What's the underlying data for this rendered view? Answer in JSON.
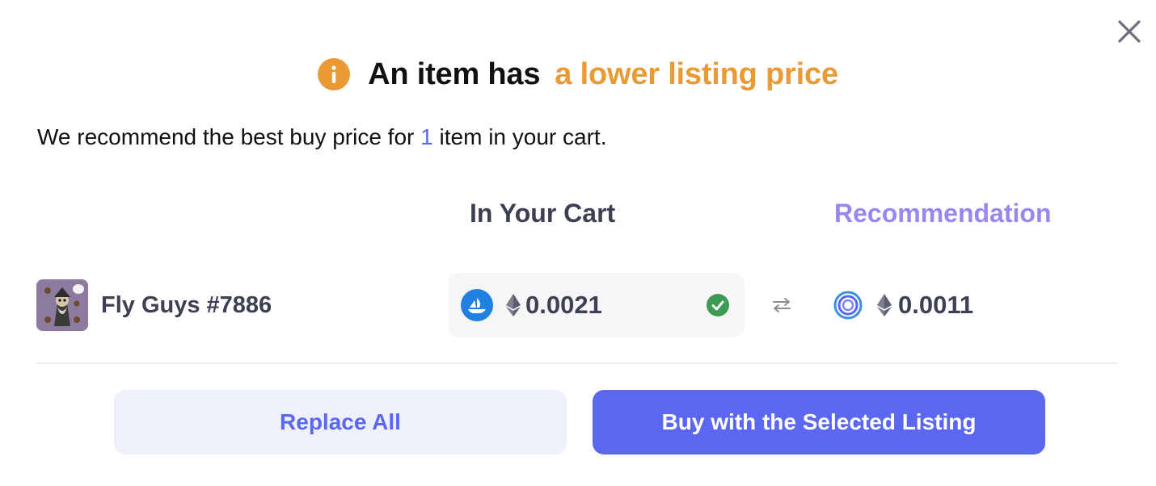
{
  "dialog": {
    "title_main": "An item has",
    "title_highlight": "a lower listing price",
    "subtitle_prefix": "We recommend the best buy price for",
    "subtitle_count": "1",
    "subtitle_suffix": "item in your cart.",
    "close_icon": "close-icon",
    "info_icon": "info-icon"
  },
  "columns": {
    "cart": "In Your Cart",
    "recommendation": "Recommendation"
  },
  "items": [
    {
      "name": "Fly Guys #7886",
      "cart_marketplace_icon": "opensea-icon",
      "cart_price": "0.0021",
      "cart_selected": true,
      "recommendation_marketplace_icon": "marketplace-ring-icon",
      "recommendation_price": "0.0011",
      "currency_icon": "ethereum-icon"
    }
  ],
  "actions": {
    "replace_all": "Replace All",
    "buy_selected": "Buy with the Selected Listing"
  },
  "colors": {
    "accent": "#5b67f0",
    "warning": "#e99a34",
    "recommendation": "#9b85f0",
    "success": "#3d9a52"
  }
}
